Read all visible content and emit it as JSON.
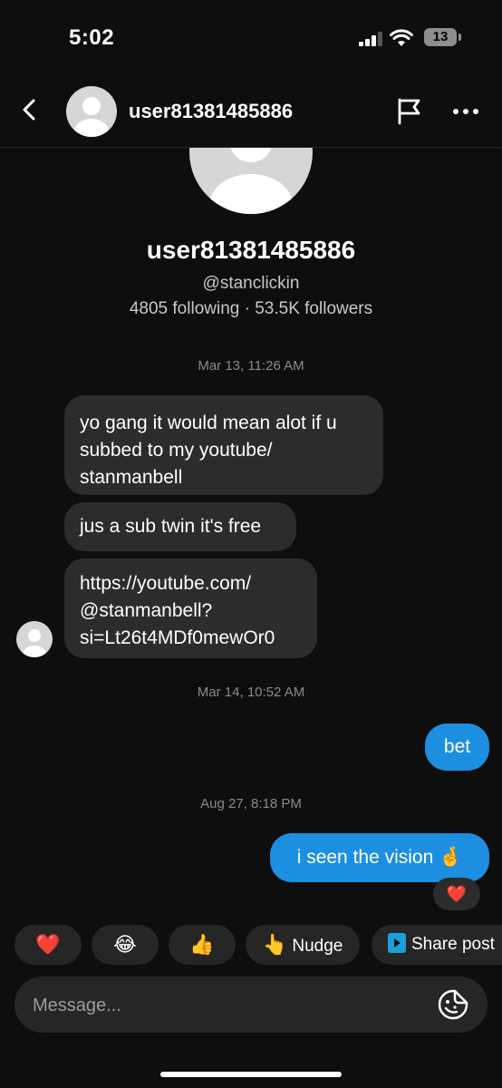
{
  "status": {
    "time": "5:02",
    "battery": "13"
  },
  "header": {
    "username": "user81381485886"
  },
  "profile": {
    "name": "user81381485886",
    "handle": "@stanclickin",
    "stats": "4805 following · 53.5K followers"
  },
  "messages": {
    "ts1": "Mar 13, 11:26 AM",
    "in1_line1": "yo gang it would mean alot if u",
    "in1_line2": "subbed to my youtube/",
    "in1_line3": "stanmanbell",
    "in2": "jus a sub twin it's free",
    "in3_line1": "https://youtube.com/",
    "in3_line2": "@stanmanbell?",
    "in3_line3": "si=Lt26t4MDf0mewOr0",
    "ts2": "Mar 14, 10:52 AM",
    "out1": "bet",
    "ts3": "Aug 27, 8:18 PM",
    "out2": "i seen the vision 🤞",
    "reaction": "❤️"
  },
  "quick_reactions": {
    "heart": "❤️",
    "laugh": "😂",
    "thumbs": "👍",
    "nudge_emoji": "👆",
    "nudge_label": "Nudge",
    "share_label": "Share post"
  },
  "composer": {
    "placeholder": "Message..."
  },
  "colors": {
    "accent": "#1d8fe0",
    "background": "#0e0e0e",
    "bubble_in": "#2c2c2c"
  },
  "icons": [
    "back-chevron-icon",
    "flag-icon",
    "more-icon",
    "sticker-icon",
    "share-play-icon"
  ]
}
